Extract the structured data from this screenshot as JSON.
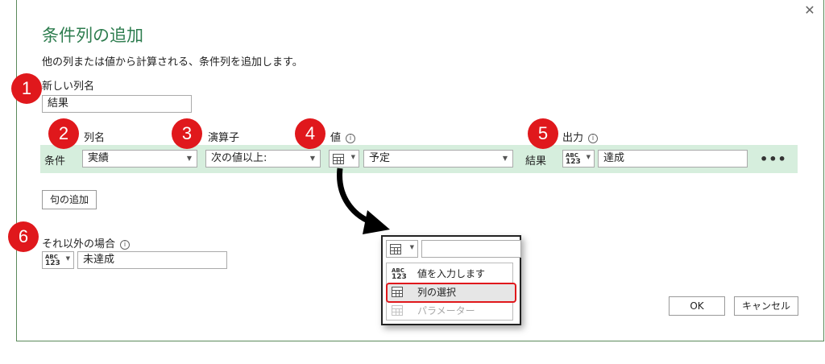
{
  "dialog": {
    "title": "条件列の追加",
    "description": "他の列または値から計算される、条件列を追加します。",
    "close_label": "✕"
  },
  "new_column": {
    "label": "新しい列名",
    "value": "結果"
  },
  "headers": {
    "column_name": "列名",
    "operator": "演算子",
    "value": "値",
    "output": "出力",
    "info": "i"
  },
  "clause": {
    "condition_label": "条件",
    "column": "実績",
    "operator": "次の値以上:",
    "value": "予定",
    "result_label": "結果",
    "output_type_top": "ABC",
    "output_type_bottom": "123",
    "output": "達成",
    "more": "•••"
  },
  "add_clause_label": "句の追加",
  "otherwise": {
    "label": "それ以外の場合",
    "type_top": "ABC",
    "type_bottom": "123",
    "value": "未達成"
  },
  "buttons": {
    "ok": "OK",
    "cancel": "キャンセル"
  },
  "badges": [
    "1",
    "2",
    "3",
    "4",
    "5",
    "6"
  ],
  "popup": {
    "input_value": "",
    "items": [
      {
        "label": "値を入力します",
        "icon_top": "ABC",
        "icon_bottom": "123"
      },
      {
        "label": "列の選択"
      },
      {
        "label": "パラメーター"
      }
    ]
  },
  "colors": {
    "accent": "#2e7d4f",
    "clause_row": "#d6eedd",
    "badge": "#e0181c"
  }
}
